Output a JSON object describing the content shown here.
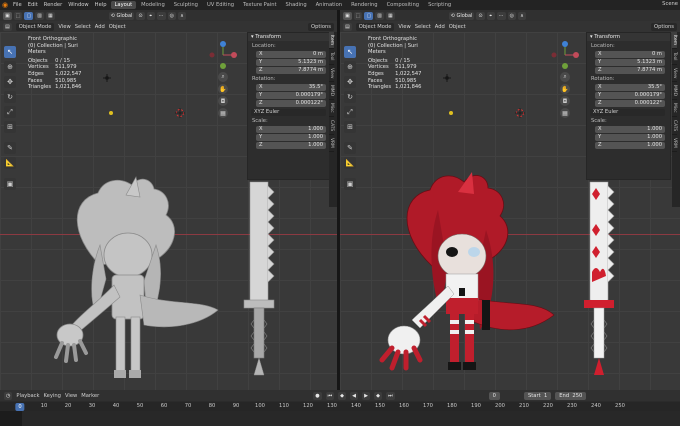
{
  "menubar": {
    "menus": [
      "File",
      "Edit",
      "Render",
      "Window",
      "Help"
    ],
    "workspaces": [
      "Layout",
      "Modeling",
      "Sculpting",
      "UV Editing",
      "Texture Paint",
      "Shading",
      "Animation",
      "Rendering",
      "Compositing",
      "Scripting"
    ],
    "active_workspace": "Layout",
    "scene_label": "Scene"
  },
  "viewport_left": {
    "mode": "Object Mode",
    "menus": [
      "View",
      "Select",
      "Add",
      "Object"
    ],
    "orientation": "Global",
    "options_label": "Options",
    "info": {
      "view": "Front Orthographic",
      "collection": "(0) Collection | Suri",
      "units": "Meters",
      "rows": [
        {
          "label": "Objects",
          "value": "0 / 15"
        },
        {
          "label": "Vertices",
          "value": "511,979"
        },
        {
          "label": "Edges",
          "value": "1,022,547"
        },
        {
          "label": "Faces",
          "value": "510,985"
        },
        {
          "label": "Triangles",
          "value": "1,021,846"
        }
      ]
    }
  },
  "viewport_right": {
    "mode": "Object Mode",
    "menus": [
      "View",
      "Select",
      "Add",
      "Object"
    ],
    "orientation": "Global",
    "options_label": "Options",
    "info": {
      "view": "Front Orthographic",
      "collection": "(0) Collection | Suri",
      "units": "Meters",
      "rows": [
        {
          "label": "Objects",
          "value": "0 / 15"
        },
        {
          "label": "Vertices",
          "value": "511,979"
        },
        {
          "label": "Edges",
          "value": "1,022,547"
        },
        {
          "label": "Faces",
          "value": "510,985"
        },
        {
          "label": "Triangles",
          "value": "1,021,846"
        }
      ]
    }
  },
  "transform_panel": {
    "title": "Transform",
    "location_label": "Location:",
    "location": [
      {
        "axis": "X",
        "value": "0 m"
      },
      {
        "axis": "Y",
        "value": "5.1323 m"
      },
      {
        "axis": "Z",
        "value": "7.8774 m"
      }
    ],
    "rotation_label": "Rotation:",
    "rotation": [
      {
        "axis": "X",
        "value": "35.5°"
      },
      {
        "axis": "Y",
        "value": "0.000179°"
      },
      {
        "axis": "Z",
        "value": "0.000122°"
      }
    ],
    "rotation_mode": "XYZ Euler",
    "scale_label": "Scale:",
    "scale": [
      {
        "axis": "X",
        "value": "1.000"
      },
      {
        "axis": "Y",
        "value": "1.000"
      },
      {
        "axis": "Z",
        "value": "1.000"
      }
    ]
  },
  "side_tabs": [
    "Item",
    "Tool",
    "View",
    "MMD",
    "Misc",
    "CATS",
    "VRM"
  ],
  "timeline": {
    "menus": [
      "Playback",
      "Keying",
      "View",
      "Marker"
    ],
    "current_frame": "0",
    "start_label": "Start",
    "start": "1",
    "end_label": "End",
    "end": "250",
    "ticks": [
      "0",
      "10",
      "20",
      "30",
      "40",
      "50",
      "60",
      "70",
      "80",
      "90",
      "100",
      "110",
      "120",
      "130",
      "140",
      "150",
      "160",
      "170",
      "180",
      "190",
      "200",
      "210",
      "220",
      "230",
      "240",
      "250"
    ]
  },
  "colors": {
    "accent_blue": "#4772b3",
    "blender_orange": "#e87d0d",
    "x_axis_red": "#8c3a42",
    "character_red": "#c8202e"
  }
}
